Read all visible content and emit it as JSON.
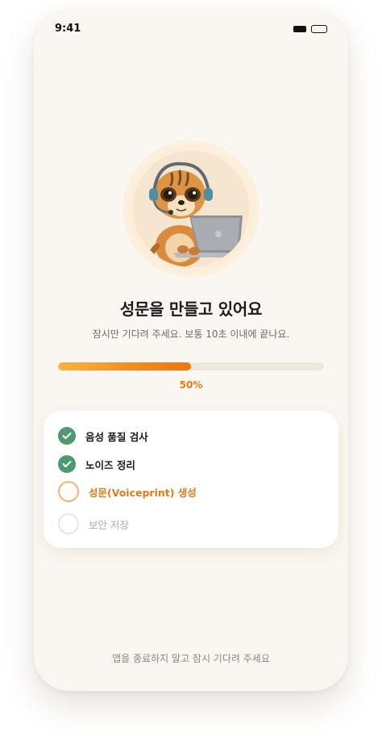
{
  "status_bar": {
    "time": "9:41"
  },
  "main": {
    "avatar_icon": "meerkat-with-laptop-illustration",
    "title": "성문을 만들고 있어요",
    "subtitle": "잠시만 기다려 주세요. 보통 10초 이내에 끝나요.",
    "progress": {
      "value_percent": 50,
      "label": "50%"
    }
  },
  "steps": {
    "items": [
      {
        "label": "음성 품질 검사",
        "state": "done",
        "icon": "check-circle-icon"
      },
      {
        "label": "노이즈 정리",
        "state": "done",
        "icon": "check-circle-icon"
      },
      {
        "label": "성문(Voiceprint) 생성",
        "state": "active",
        "icon": "progress-ring-icon"
      },
      {
        "label": "보안 저장",
        "state": "pending",
        "icon": "empty-circle-icon"
      }
    ]
  },
  "footer": {
    "note": "앱을 종료하지 말고 잠시 기다려 주세요"
  },
  "colors": {
    "accent": "#ee7410",
    "done_green": "#4e9a6e",
    "background": "#faf7f2"
  }
}
